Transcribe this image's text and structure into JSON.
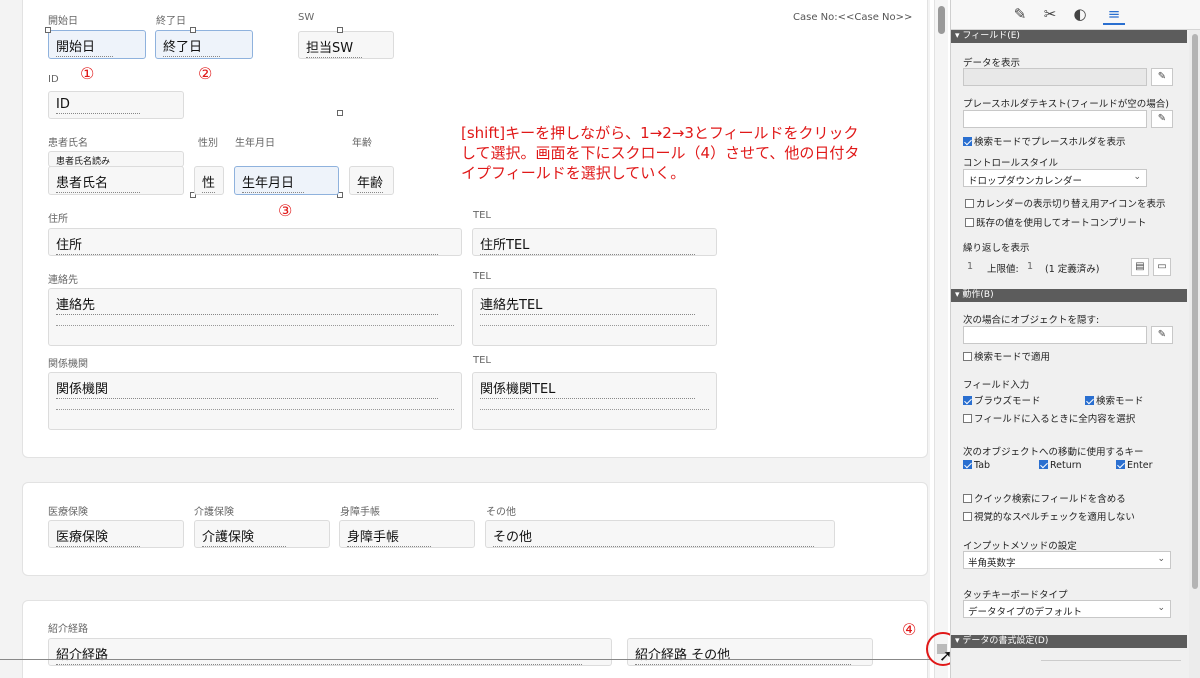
{
  "case_no": "Case No:<<Case No>>",
  "section1": {
    "start_date": {
      "label": "開始日",
      "value": "開始日"
    },
    "end_date": {
      "label": "終了日",
      "value": "終了日"
    },
    "sw": {
      "label": "SW",
      "value": "担当SW"
    },
    "id": {
      "label": "ID",
      "value": "ID"
    },
    "patient": {
      "label": "患者氏名",
      "kana": "患者氏名読み",
      "value": "患者氏名"
    },
    "sex": {
      "label": "性別",
      "value": "性"
    },
    "birth": {
      "label": "生年月日",
      "value": "生年月日"
    },
    "age": {
      "label": "年齢",
      "value": "年齢"
    },
    "address": {
      "label": "住所",
      "value": "住所"
    },
    "address_tel": {
      "label": "TEL",
      "value": "住所TEL"
    },
    "contact": {
      "label": "連絡先",
      "value": "連絡先"
    },
    "contact_tel": {
      "label": "TEL",
      "value": "連絡先TEL"
    },
    "org": {
      "label": "関係機関",
      "value": "関係機関"
    },
    "org_tel": {
      "label": "TEL",
      "value": "関係機関TEL"
    }
  },
  "section2": {
    "medical": {
      "label": "医療保険",
      "value": "医療保険"
    },
    "care": {
      "label": "介護保険",
      "value": "介護保険"
    },
    "disability": {
      "label": "身障手帳",
      "value": "身障手帳"
    },
    "other": {
      "label": "その他",
      "value": "その他"
    }
  },
  "section3": {
    "route": {
      "label": "紹介経路",
      "value": "紹介経路"
    },
    "route_other": {
      "value": "紹介経路 その他"
    }
  },
  "annotations": {
    "n1": "①",
    "n2": "②",
    "n3": "③",
    "n4": "④",
    "instruction": "[shift]キーを押しながら、1→2→3とフィールドをクリックして選択。画面を下にスクロール（4）させて、他の日付タイプフィールドを選択していく。"
  },
  "inspector": {
    "field_section": "フィールド(E)",
    "show_data": "データを表示",
    "placeholder_label": "プレースホルダテキスト(フィールドが空の場合)",
    "show_placeholder_find": "検索モードでプレースホルダを表示",
    "control_style": "コントロールスタイル",
    "control_style_value": "ドロップダウンカレンダー",
    "show_calendar_icon": "カレンダーの表示切り替え用アイコンを表示",
    "autocomplete": "既存の値を使用してオートコンプリート",
    "repetitions": "繰り返しを表示",
    "rep_from": "1",
    "rep_max_label": "上限値:",
    "rep_max": "1",
    "rep_defined": "(1 定義済み)",
    "behavior_section": "動作(B)",
    "hide_object": "次の場合にオブジェクトを隠す:",
    "apply_find": "検索モードで適用",
    "field_entry": "フィールド入力",
    "browse_mode": "ブラウズモード",
    "find_mode": "検索モード",
    "select_all": "フィールドに入るときに全内容を選択",
    "next_object_keys": "次のオブジェクトへの移動に使用するキー",
    "key_tab": "Tab",
    "key_return": "Return",
    "key_enter": "Enter",
    "quick_find": "クイック検索にフィールドを含める",
    "no_spellcheck": "視覚的なスペルチェックを適用しない",
    "input_method": "インプットメソッドの設定",
    "input_method_value": "半角英数字",
    "touch_keyboard": "タッチキーボードタイプ",
    "touch_keyboard_value": "データタイプのデフォルト",
    "format_section": "データの書式設定(D)"
  }
}
